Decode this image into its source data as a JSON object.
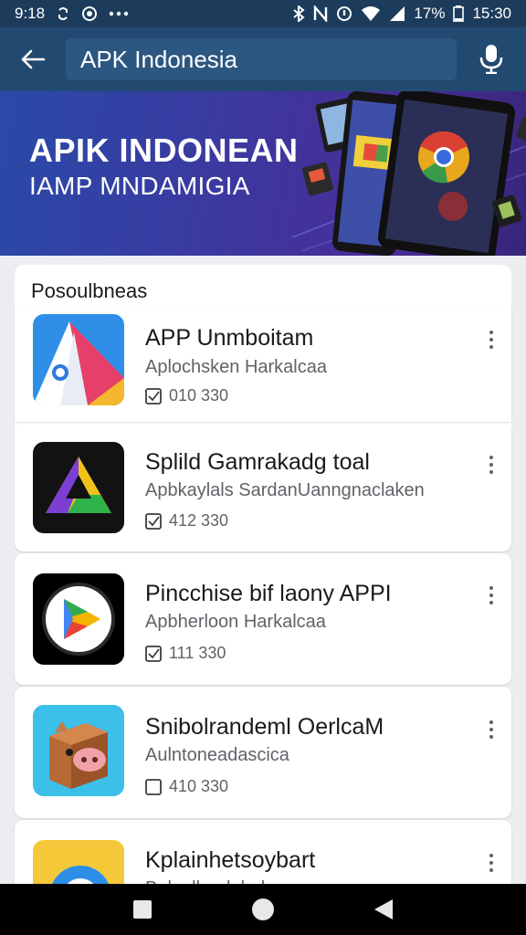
{
  "status_bar": {
    "time": "9:18",
    "battery_percent": "17%",
    "clock_right": "15:30"
  },
  "search": {
    "query": "APK Indonesia"
  },
  "banner": {
    "title": "APIK INDONEAN",
    "subtitle": "IAMP MNDAMIGIA"
  },
  "section": {
    "title": "Posoulbneas"
  },
  "apps": [
    {
      "name": "APP Unmboitam",
      "developer": "Aplochsken Harkalcaa",
      "downloads": "010 330"
    },
    {
      "name": "Splild Gamrakadg toal",
      "developer": "Apbkaylals SardanUanngnaclaken",
      "downloads": "412 330"
    },
    {
      "name": "Pincchise bif laony APPI",
      "developer": "Apbherloon Harkalcaa",
      "downloads": "111 330"
    },
    {
      "name": "Snibolrandeml OerlcaM",
      "developer": "Aulntoneadascica",
      "downloads": "410 330"
    },
    {
      "name": "Kplainhetsoybart",
      "developer": "Bplonlhunlohalcaa",
      "downloads": ""
    }
  ],
  "icons": {
    "back": "arrow-left-icon",
    "mic": "microphone-icon",
    "more": "more-vert-icon",
    "check": "checkbox-icon",
    "nav": [
      "recents-icon",
      "home-icon",
      "back-icon"
    ]
  },
  "colors": {
    "status_bar": "#1d3c5c",
    "app_bar": "#224a70",
    "search_box": "#2c5781",
    "banner_start": "#2a4aa8",
    "banner_end": "#36267a",
    "nav_bar": "#000000"
  }
}
